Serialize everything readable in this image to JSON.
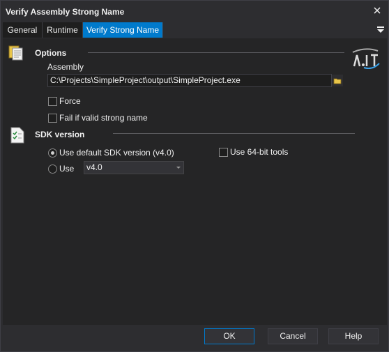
{
  "window": {
    "title": "Verify Assembly Strong Name"
  },
  "tabs": [
    {
      "label": "General",
      "active": false
    },
    {
      "label": "Runtime",
      "active": false
    },
    {
      "label": "Verify Strong Name",
      "active": true
    }
  ],
  "options": {
    "title": "Options",
    "assembly_label": "Assembly",
    "assembly_value": "C:\\Projects\\SimpleProject\\output\\SimpleProject.exe",
    "force_label": "Force",
    "force_checked": false,
    "fail_label": "Fail if valid strong name",
    "fail_checked": false
  },
  "sdk": {
    "title": "SDK version",
    "default_label": "Use default SDK version (v4.0)",
    "use_label": "Use",
    "use_value": "v4.0",
    "use64_label": "Use 64-bit tools",
    "use64_checked": false,
    "selected": "default"
  },
  "buttons": {
    "ok": "OK",
    "cancel": "Cancel",
    "help": "Help"
  },
  "colors": {
    "accent": "#007acc",
    "background": "#252526",
    "text": "#f0f0f0"
  }
}
